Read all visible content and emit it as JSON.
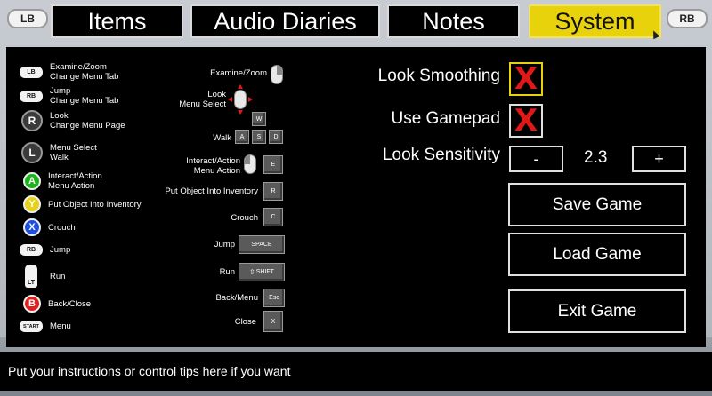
{
  "tabs": {
    "left_bumper": "LB",
    "right_bumper": "RB",
    "items": [
      "Items",
      "Audio Diaries",
      "Notes",
      "System"
    ],
    "active": "System"
  },
  "gamepad_controls": [
    {
      "icon": "LB",
      "text": "Examine/Zoom\nChange Menu Tab"
    },
    {
      "icon": "RB",
      "text": "Jump\nChange Menu Tab"
    },
    {
      "icon": "R",
      "text": "Look\nChange Menu Page"
    },
    {
      "icon": "L",
      "text": "Menu Select\nWalk"
    },
    {
      "icon": "A",
      "text": "Interact/Action\nMenu Action"
    },
    {
      "icon": "Y",
      "text": "Put Object Into Inventory"
    },
    {
      "icon": "X",
      "text": "Crouch"
    },
    {
      "icon": "RB",
      "text": "Jump"
    },
    {
      "icon": "LT",
      "text": "Run"
    },
    {
      "icon": "B",
      "text": "Back/Close"
    },
    {
      "icon": "START",
      "text": "Menu"
    }
  ],
  "face_colors": {
    "A": "#1db31d",
    "Y": "#e6d21a",
    "X": "#1f4fe0",
    "B": "#e02020"
  },
  "keyboard_controls": {
    "examine_zoom": "Examine/Zoom",
    "look": "Look\nMenu Select",
    "walk": "Walk",
    "walk_keys": [
      "W",
      "A",
      "S",
      "D"
    ],
    "interact": "Interact/Action\nMenu Action",
    "interact_key": "E",
    "inventory": "Put Object Into Inventory",
    "inventory_key": "R",
    "crouch": "Crouch",
    "crouch_key": "C",
    "jump": "Jump",
    "jump_key": "SPACE",
    "run": "Run",
    "run_key": "SHIFT",
    "back": "Back/Menu",
    "back_key": "Esc",
    "close": "Close",
    "close_key": "X"
  },
  "settings": {
    "look_smoothing": {
      "label": "Look Smoothing",
      "checked": "X"
    },
    "use_gamepad": {
      "label": "Use Gamepad",
      "checked": "X"
    },
    "look_sensitivity": {
      "label": "Look Sensitivity",
      "value": "2.3",
      "minus": "-",
      "plus": "+"
    }
  },
  "buttons": {
    "save": "Save Game",
    "load": "Load Game",
    "exit": "Exit Game"
  },
  "footer": "Put your instructions or control tips here if you want"
}
